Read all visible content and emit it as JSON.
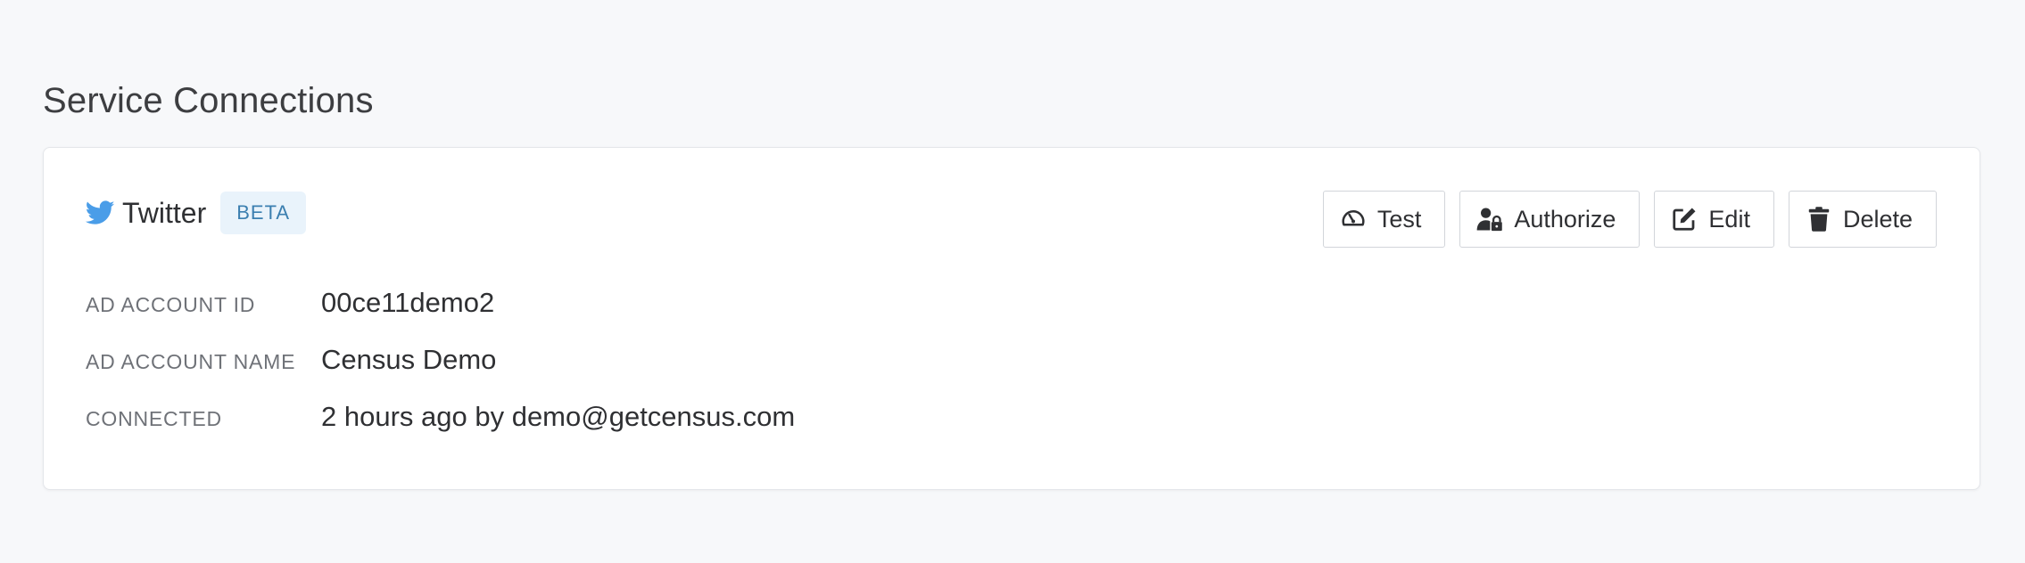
{
  "page": {
    "title": "Service Connections"
  },
  "connection": {
    "service_name": "Twitter",
    "badge": "BETA",
    "icon": "twitter-bird-icon",
    "brand_color": "#4a9de8",
    "actions": [
      {
        "label": "Test",
        "icon": "gauge-icon"
      },
      {
        "label": "Authorize",
        "icon": "user-lock-icon"
      },
      {
        "label": "Edit",
        "icon": "edit-icon"
      },
      {
        "label": "Delete",
        "icon": "trash-icon"
      }
    ],
    "details": [
      {
        "label": "AD ACCOUNT ID",
        "value": "00ce11demo2"
      },
      {
        "label": "AD ACCOUNT NAME",
        "value": "Census Demo"
      },
      {
        "label": "CONNECTED",
        "value": "2 hours ago by demo@getcensus.com"
      }
    ]
  }
}
